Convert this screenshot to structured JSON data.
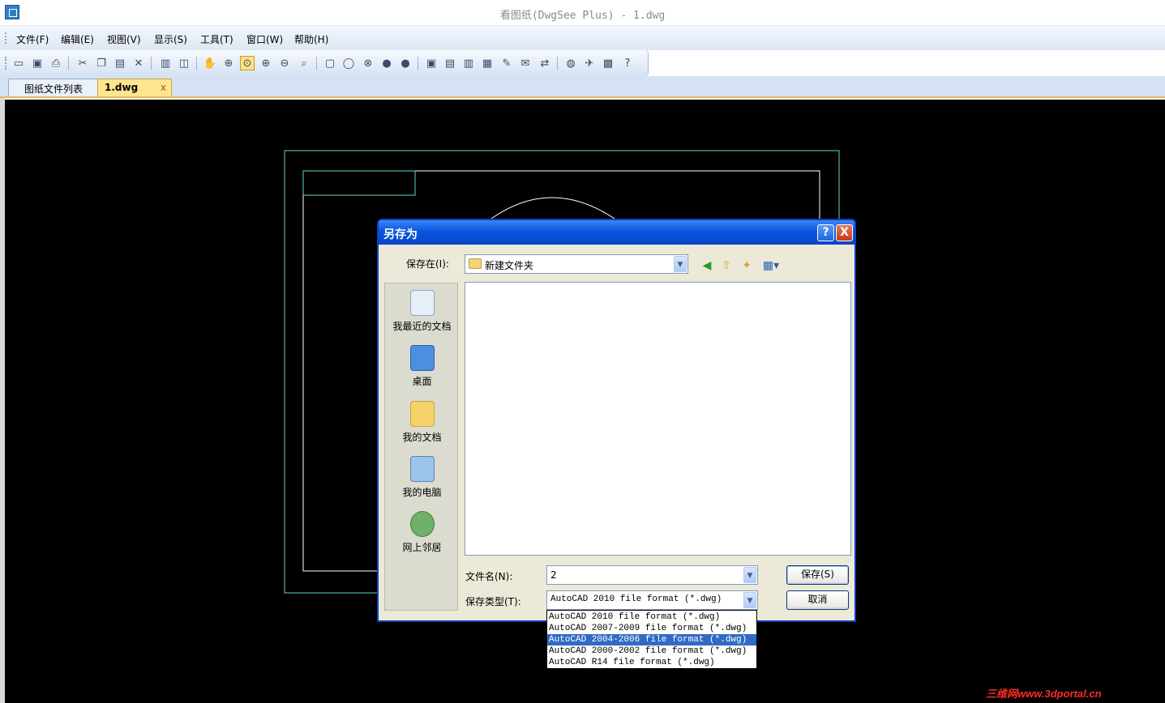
{
  "window": {
    "title": "看图纸(DwgSee Plus) - 1.dwg",
    "app_icon": "app-icon"
  },
  "menu": [
    "文件(F)",
    "编辑(E)",
    "视图(V)",
    "显示(S)",
    "工具(T)",
    "窗口(W)",
    "帮助(H)"
  ],
  "toolbar": {
    "buttons": [
      "open-icon",
      "save-icon",
      "print-icon",
      "cut-icon",
      "copy-icon",
      "paste-icon",
      "delete-icon",
      "layout-icon",
      "layers-icon",
      "pan-icon",
      "zoom-window-icon",
      "zoom-extents-icon",
      "zoom-in-icon",
      "zoom-out-icon",
      "zoom-realtime-icon",
      "frame-icon",
      "circle-icon",
      "circle-x-icon",
      "dot-icon",
      "dot2-icon",
      "panel1-icon",
      "panel2-icon",
      "panel3-icon",
      "panel4-icon",
      "measure-icon",
      "annotate-icon",
      "convert-icon",
      "web-icon",
      "send-icon",
      "package-icon",
      "help-icon"
    ]
  },
  "tabs": [
    {
      "label": "图纸文件列表",
      "active": false
    },
    {
      "label": "1.dwg",
      "active": true,
      "close": "x"
    }
  ],
  "dialog": {
    "title": "另存为",
    "help_button": "?",
    "close_button": "X",
    "save_in_label": "保存在(I):",
    "save_in_value": "新建文件夹",
    "places": [
      {
        "label": "我最近的文档",
        "icon": "recent-documents-icon"
      },
      {
        "label": "桌面",
        "icon": "desktop-icon"
      },
      {
        "label": "我的文档",
        "icon": "my-documents-icon"
      },
      {
        "label": "我的电脑",
        "icon": "my-computer-icon"
      },
      {
        "label": "网上邻居",
        "icon": "network-places-icon"
      }
    ],
    "filename_label": "文件名(N):",
    "filename_value": "2",
    "filetype_label": "保存类型(T):",
    "filetype_value": "AutoCAD 2010 file format (*.dwg)",
    "save_button": "保存(S)",
    "cancel_button": "取消",
    "filetype_options": [
      "AutoCAD 2010 file format (*.dwg)",
      "AutoCAD 2007-2009 file format (*.dwg)",
      "AutoCAD 2004-2006 file format (*.dwg)",
      "AutoCAD 2000-2002 file format (*.dwg)",
      "AutoCAD R14 file format (*.dwg)"
    ],
    "highlighted_option_index": 2
  },
  "watermark": "三维网www.3dportal.cn"
}
